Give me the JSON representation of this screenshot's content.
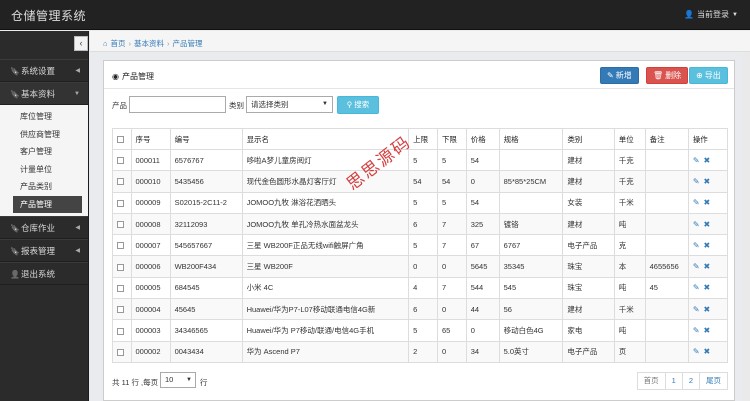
{
  "app": {
    "title": "仓储管理系统",
    "user_menu": "当前登录"
  },
  "sidebar": {
    "collapse_glyph": "‹",
    "items": [
      {
        "label": "系统设置",
        "icon": "bookmark-icon"
      },
      {
        "label": "基本资料",
        "icon": "bookmark-icon",
        "open": true,
        "children": [
          "库位管理",
          "供应商管理",
          "客户管理",
          "计量单位",
          "产品类别",
          "产品管理"
        ]
      },
      {
        "label": "仓库作业",
        "icon": "bookmark-icon"
      },
      {
        "label": "报表管理",
        "icon": "bookmark-icon"
      },
      {
        "label": "退出系统",
        "icon": "user-icon"
      }
    ],
    "active_child": "产品管理"
  },
  "breadcrumb": [
    "首页",
    "基本资料",
    "产品管理"
  ],
  "panel": {
    "title": "产品管理",
    "buttons": {
      "add": "新增",
      "delete": "删除",
      "export": "导出"
    }
  },
  "search": {
    "product_label": "产品",
    "product_value": "",
    "category_label": "类别",
    "category_selected": "请选择类别",
    "search_button": "搜索"
  },
  "table": {
    "columns": [
      "序号",
      "编号",
      "显示名",
      "上限",
      "下限",
      "价格",
      "规格",
      "类别",
      "单位",
      "备注",
      "操作"
    ],
    "rows": [
      [
        "000011",
        "6576767",
        "哆啦A梦儿童房阅灯",
        "5",
        "5",
        "54",
        "",
        "建材",
        "千克",
        ""
      ],
      [
        "000010",
        "5435456",
        "现代金色圆形水晶灯客厅灯",
        "54",
        "54",
        "0",
        "85*85*25CM",
        "建材",
        "千克",
        ""
      ],
      [
        "000009",
        "S02015-2C11-2",
        "JOMOO九牧 淋浴花洒晒头",
        "5",
        "5",
        "54",
        "",
        "女装",
        "千米",
        ""
      ],
      [
        "000008",
        "32112093",
        "JOMOO九牧 单孔冷热水面盆龙头",
        "6",
        "7",
        "325",
        "镀铬",
        "建材",
        "吨",
        ""
      ],
      [
        "000007",
        "545657667",
        "三星 WB200F正品无线wifi触屏广角",
        "5",
        "7",
        "67",
        "6767",
        "电子产品",
        "克",
        ""
      ],
      [
        "000006",
        "WB200F434",
        "三星 WB200F",
        "0",
        "0",
        "5645",
        "35345",
        "珠宝",
        "本",
        "4655656"
      ],
      [
        "000005",
        "684545",
        "小米 4C",
        "4",
        "7",
        "544",
        "545",
        "珠宝",
        "吨",
        "45"
      ],
      [
        "000004",
        "45645",
        "Huawei/华为P7-L07移动联通电信4G新",
        "6",
        "0",
        "44",
        "56",
        "建材",
        "千米",
        ""
      ],
      [
        "000003",
        "34346565",
        "Huawei/华为 P7移动/联通/电信4G手机",
        "5",
        "65",
        "0",
        "移动白色4G",
        "家电",
        "吨",
        ""
      ],
      [
        "000002",
        "0043434",
        "华为 Ascend P7",
        "2",
        "0",
        "34",
        "5.0英寸",
        "电子产品",
        "页",
        ""
      ]
    ]
  },
  "footer": {
    "prefix": "共 11 行 ,每页",
    "page_size": "10",
    "suffix": "行"
  },
  "pager": {
    "first": "首页",
    "pages": [
      "1",
      "2"
    ],
    "last": "尾页"
  },
  "watermark": "思思源码"
}
